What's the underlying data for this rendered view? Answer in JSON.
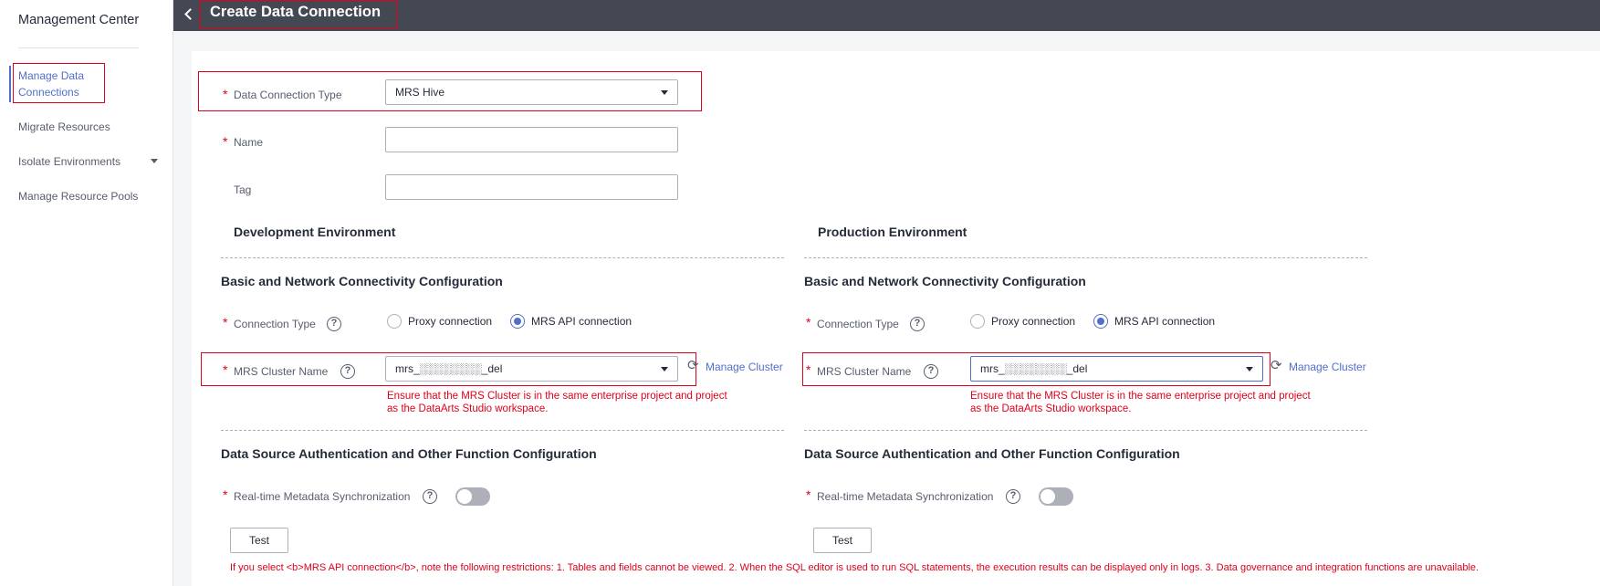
{
  "sidebar": {
    "title": "Management Center",
    "items": [
      {
        "label": "Manage Data Connections"
      },
      {
        "label": "Migrate Resources"
      },
      {
        "label": "Isolate Environments"
      },
      {
        "label": "Manage Resource Pools"
      }
    ]
  },
  "header": {
    "title": "Create Data Connection"
  },
  "form": {
    "connection_type_label": "Data Connection Type",
    "connection_type_value": "MRS Hive",
    "name_label": "Name",
    "name_value": "",
    "tag_label": "Tag",
    "tag_value": ""
  },
  "environments": [
    {
      "heading": "Development Environment",
      "basic_heading": "Basic and Network Connectivity Configuration",
      "connection_type_label": "Connection Type",
      "radio_proxy": "Proxy connection",
      "radio_api": "MRS API connection",
      "selected": "MRS API connection",
      "cluster_label": "MRS Cluster Name",
      "cluster_value": "mrs_░░░░░░░░_del",
      "manage_cluster": "Manage Cluster",
      "cluster_hint_1": "Ensure that the MRS Cluster is in the same enterprise project and project",
      "cluster_hint_2": "as the DataArts Studio workspace.",
      "auth_heading": "Data Source Authentication and Other Function Configuration",
      "realtime_label": "Real-time Metadata Synchronization",
      "realtime_on": false,
      "test_label": "Test"
    },
    {
      "heading": "Production Environment",
      "basic_heading": "Basic and Network Connectivity Configuration",
      "connection_type_label": "Connection Type",
      "radio_proxy": "Proxy connection",
      "radio_api": "MRS API connection",
      "selected": "MRS API connection",
      "cluster_label": "MRS Cluster Name",
      "cluster_value": "mrs_░░░░░░░░_del",
      "manage_cluster": "Manage Cluster",
      "cluster_hint_1": "Ensure that the MRS Cluster is in the same enterprise project and project",
      "cluster_hint_2": "as the DataArts Studio workspace.",
      "auth_heading": "Data Source Authentication and Other Function Configuration",
      "realtime_label": "Real-time Metadata Synchronization",
      "realtime_on": false,
      "test_label": "Test"
    }
  ],
  "footnote": "If you select <b>MRS API connection</b>, note the following restrictions: 1. Tables and fields cannot be viewed. 2. When the SQL editor is used to run SQL statements, the execution results can be displayed only in logs. 3. Data governance and integration functions are unavailable.",
  "colors": {
    "accent": "#526ecc",
    "error": "#e0001b",
    "header_bg": "#434853"
  }
}
